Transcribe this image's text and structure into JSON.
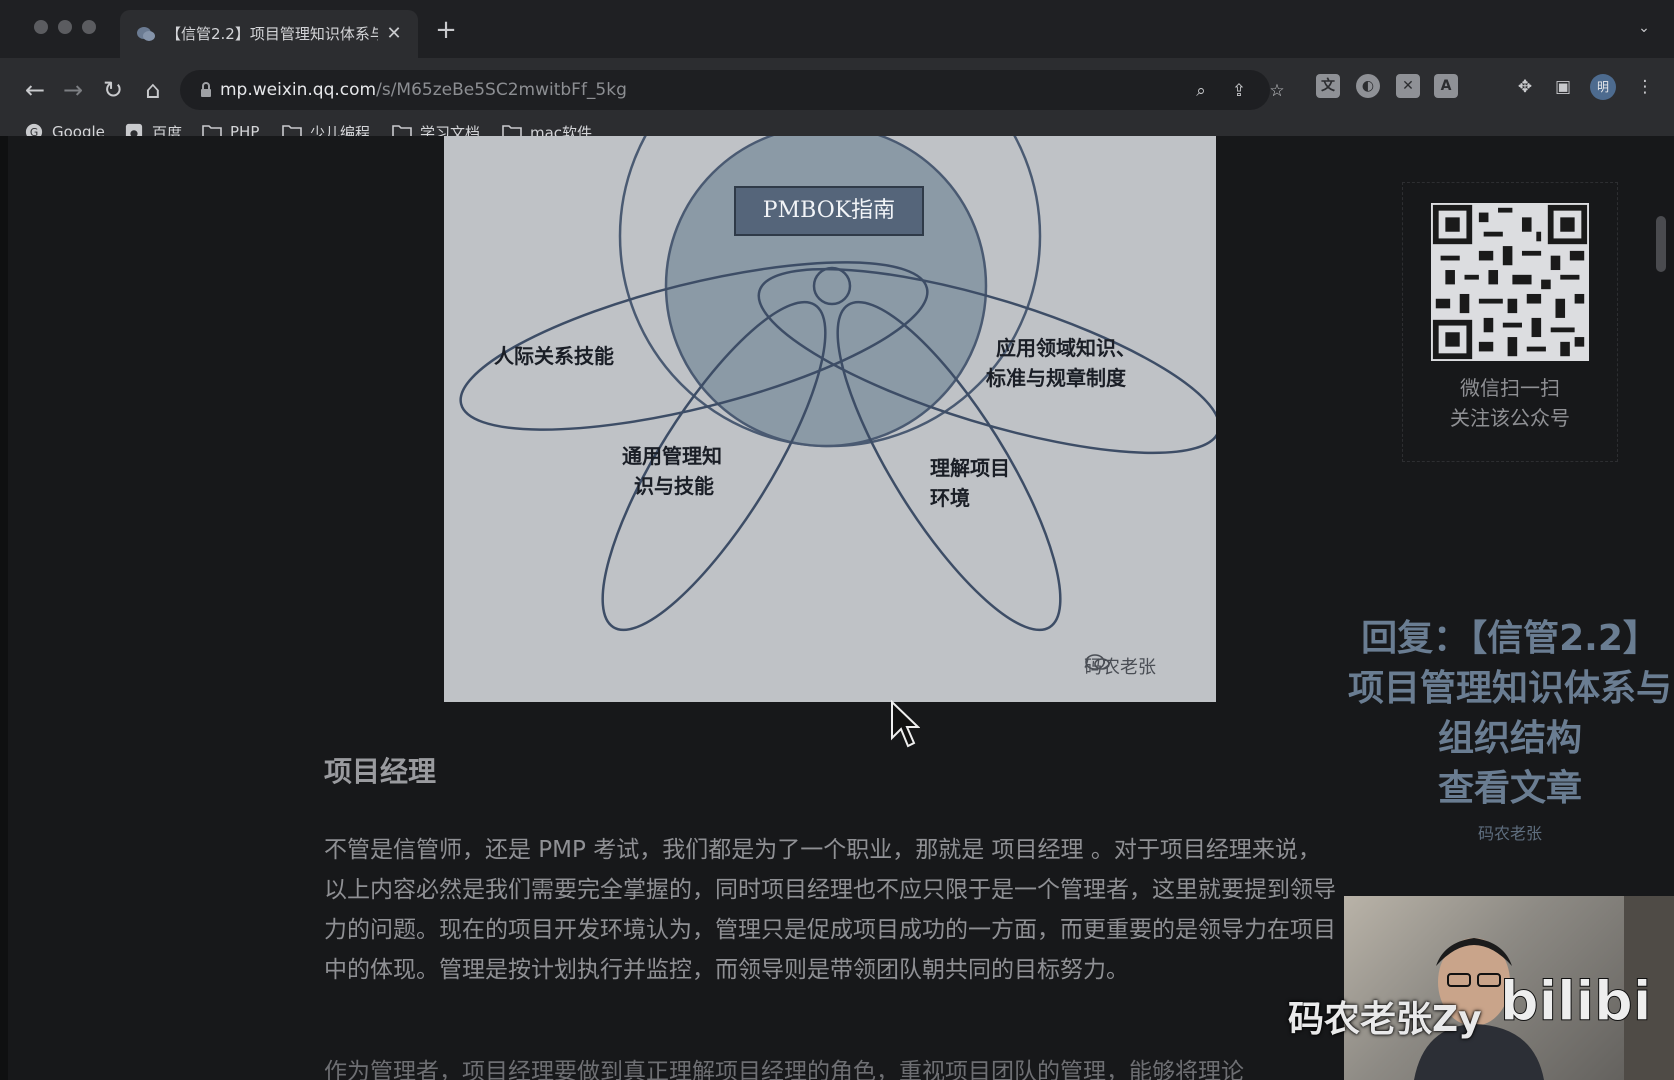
{
  "browser": {
    "tab_title": "【信管2.2】项目管理知识体系与",
    "new_tab_label": "+",
    "close_label": "✕",
    "url_host": "mp.weixin.qq.com",
    "url_path": "/s/M65zeBe5SC2mwitbFf_5kg",
    "profile_initial": "明",
    "extension_a_label": "A",
    "bookmarks": [
      {
        "label": "Google",
        "icon": "google-icon"
      },
      {
        "label": "百度",
        "icon": "baidu-icon"
      },
      {
        "label": "PHP",
        "icon": "folder-icon"
      },
      {
        "label": "少儿编程",
        "icon": "folder-icon"
      },
      {
        "label": "学习文档",
        "icon": "folder-icon"
      },
      {
        "label": "mac软件",
        "icon": "folder-icon"
      }
    ]
  },
  "figure": {
    "center_label": "PMBOK指南",
    "labels": {
      "interpersonal": "人际关系技能",
      "application_line1": "应用领域知识、",
      "application_line2": "标准与规章制度",
      "general_line1": "通用管理知",
      "general_line2": "识与技能",
      "environment_line1": "理解项目",
      "environment_line2": "环境"
    },
    "watermark": "码农老张"
  },
  "article": {
    "heading": "项目经理",
    "paragraph": "不管是信管师，还是 PMP 考试，我们都是为了一个职业，那就是 项目经理 。对于项目经理来说，以上内容必然是我们需要完全掌握的，同时项目经理也不应只限于是一个管理者，这里就要提到领导力的问题。现在的项目开发环境认为，管理只是促成项目成功的一方面，而更重要的是领导力在项目中的体现。管理是按计划执行并监控，而领导则是带领团队朝共同的目标努力。",
    "next_line_partial": "作为管理者，项目经理要做到真正理解项目经理的角色，重视项目团队的管理，能够将理论"
  },
  "sidebar": {
    "qr_line1": "微信扫一扫",
    "qr_line2": "关注该公众号"
  },
  "overlay": {
    "reply_line1": "回复：【信管2.2】",
    "reply_line2": "项目管理知识体系与",
    "reply_line3": "组织结构",
    "reply_line4": "查看文章",
    "reply_sub": "码农老张",
    "uploader": "码农老张Zy",
    "platform": "bilibili"
  }
}
